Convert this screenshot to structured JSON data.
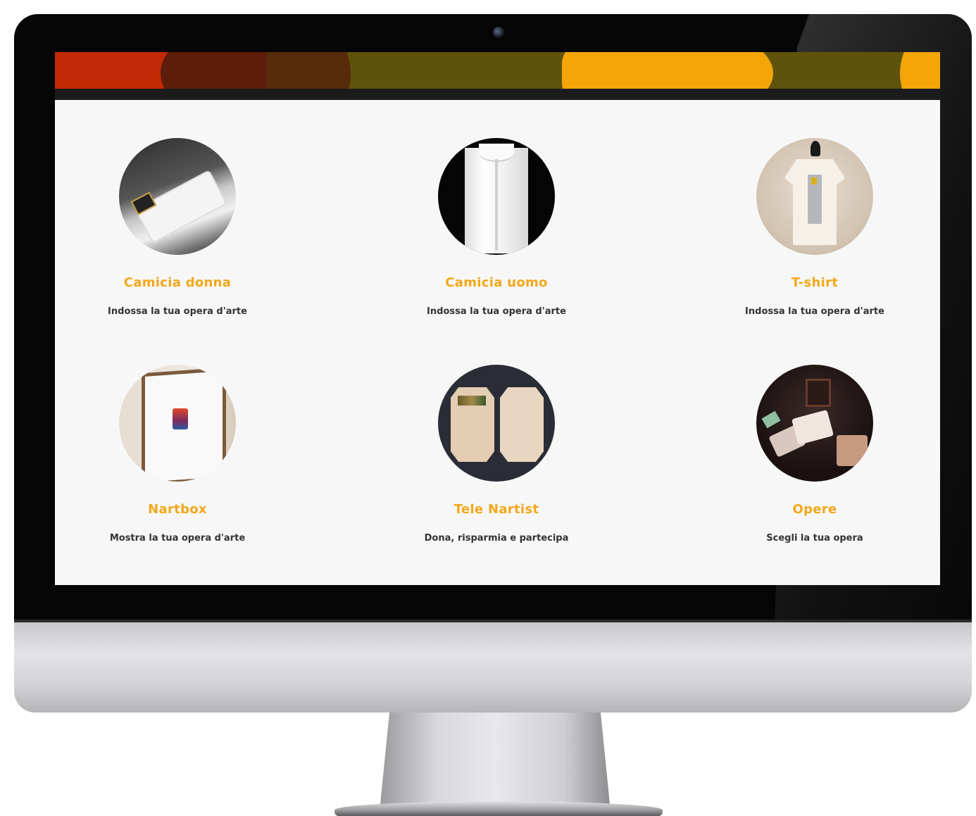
{
  "products": [
    {
      "title": "Camicia donna",
      "subtitle": "Indossa la tua opera d'arte",
      "image": "women-shirt-photo"
    },
    {
      "title": "Camicia uomo",
      "subtitle": "Indossa la tua opera d'arte",
      "image": "men-shirt-photo"
    },
    {
      "title": "T-shirt",
      "subtitle": "Indossa la tua opera d'arte",
      "image": "tshirt-mannequin-photo"
    },
    {
      "title": "Nartbox",
      "subtitle": "Mostra la tua opera d'arte",
      "image": "framed-art-box-photo"
    },
    {
      "title": "Tele Nartist",
      "subtitle": "Dona, risparmia e partecipa",
      "image": "octagon-canvas-photo"
    },
    {
      "title": "Opere",
      "subtitle": "Scegli la tua opera",
      "image": "artworks-collection-photo"
    }
  ],
  "colors": {
    "accent": "#f2a81a",
    "banner_red": "#c22a06",
    "banner_brown": "#5d1d0a",
    "banner_olive": "#5e530a",
    "banner_orange": "#f3a50a",
    "nav_strip": "#1b1b1b",
    "page_bg": "#f7f7f7",
    "subtitle_text": "#333333"
  }
}
